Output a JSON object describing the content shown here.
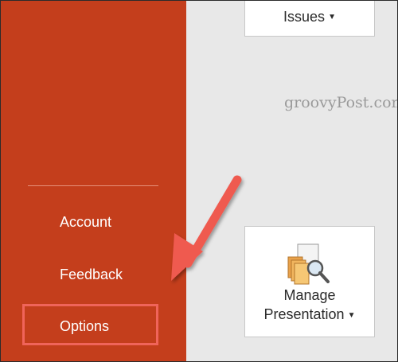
{
  "sidebar": {
    "items": [
      {
        "label": "Account"
      },
      {
        "label": "Feedback"
      },
      {
        "label": "Options"
      }
    ]
  },
  "main": {
    "issues_label": "Issues",
    "manage_label_line1": "Manage",
    "manage_label_line2": "Presentation"
  },
  "watermark": "groovyPost.com",
  "icons": [
    "chevron-down-icon",
    "manage-presentation-icon",
    "arrow-annotation-icon"
  ],
  "colors": {
    "sidebar_bg": "#c43e1c",
    "highlight": "#f0645a",
    "main_bg": "#e8e8e8"
  }
}
